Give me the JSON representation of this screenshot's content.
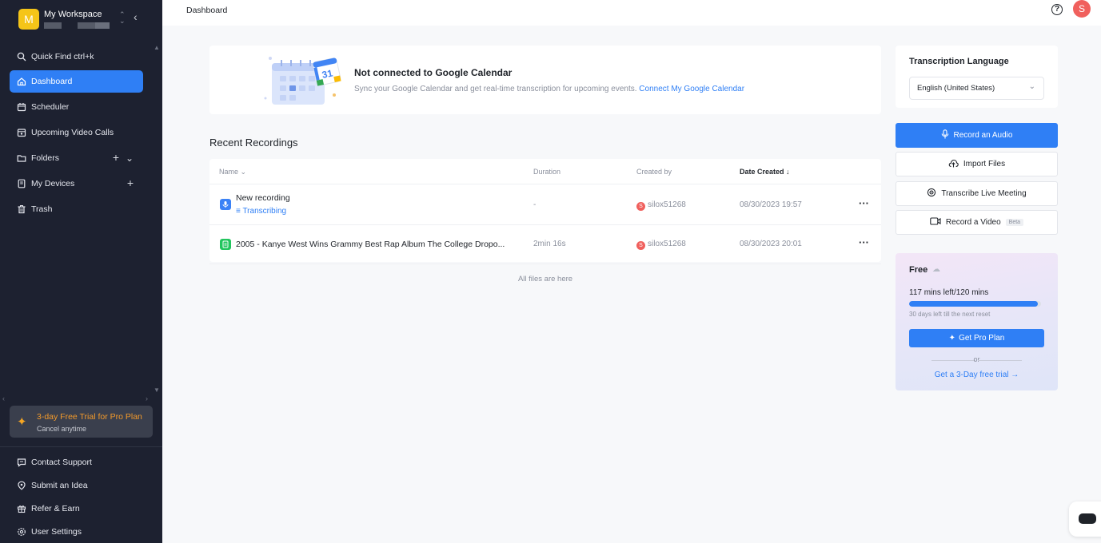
{
  "workspace": {
    "initial": "M",
    "name": "My Workspace"
  },
  "sidebar": {
    "quick_find": "Quick Find ctrl+k",
    "items": [
      {
        "label": "Dashboard",
        "icon": "home-icon"
      },
      {
        "label": "Scheduler",
        "icon": "calendar-icon"
      },
      {
        "label": "Upcoming Video Calls",
        "icon": "video-call-icon"
      },
      {
        "label": "Folders",
        "icon": "folder-icon"
      },
      {
        "label": "My Devices",
        "icon": "devices-icon"
      },
      {
        "label": "Trash",
        "icon": "trash-icon"
      }
    ],
    "trial": {
      "title": "3-day Free Trial for Pro Plan",
      "subtitle": "Cancel anytime"
    },
    "bottom": [
      {
        "label": "Contact Support",
        "icon": "support-icon"
      },
      {
        "label": "Submit an Idea",
        "icon": "idea-icon"
      },
      {
        "label": "Refer & Earn",
        "icon": "gift-icon"
      },
      {
        "label": "User Settings",
        "icon": "settings-icon"
      }
    ]
  },
  "topbar": {
    "breadcrumb": "Dashboard",
    "user_initial": "S"
  },
  "calendar_banner": {
    "day": "31",
    "title": "Not connected to Google Calendar",
    "description": "Sync your Google Calendar and get real-time transcription for upcoming events.",
    "link": "Connect My Google Calendar"
  },
  "recordings": {
    "title": "Recent Recordings",
    "columns": {
      "name": "Name",
      "duration": "Duration",
      "created_by": "Created by",
      "date_created": "Date Created"
    },
    "rows": [
      {
        "name": "New recording",
        "status": "Transcribing",
        "duration": "-",
        "creator": "silox51268",
        "creator_initial": "S",
        "date": "08/30/2023 19:57"
      },
      {
        "name": "2005 - Kanye West Wins Grammy Best Rap Album The College Dropo...",
        "status": "",
        "duration": "2min 16s",
        "creator": "silox51268",
        "creator_initial": "S",
        "date": "08/30/2023 20:01"
      }
    ],
    "footer": "All files are here"
  },
  "language": {
    "title": "Transcription Language",
    "value": "English (United States)"
  },
  "actions": {
    "record_audio": "Record an Audio",
    "import_files": "Import Files",
    "transcribe_live": "Transcribe Live Meeting",
    "record_video": "Record a Video",
    "beta": "Beta"
  },
  "plan": {
    "name": "Free",
    "minutes": "117 mins left/120 mins",
    "used_fraction": 0.975,
    "reset": "30 days left till the next reset",
    "cta": "Get Pro Plan",
    "or": "or",
    "trial_link": "Get a 3-Day free trial →"
  },
  "colors": {
    "accent": "#2f7ff5",
    "sidebar_bg": "#1d2130",
    "trial_orange": "#f39a2b",
    "avatar_red": "#f0605d"
  }
}
